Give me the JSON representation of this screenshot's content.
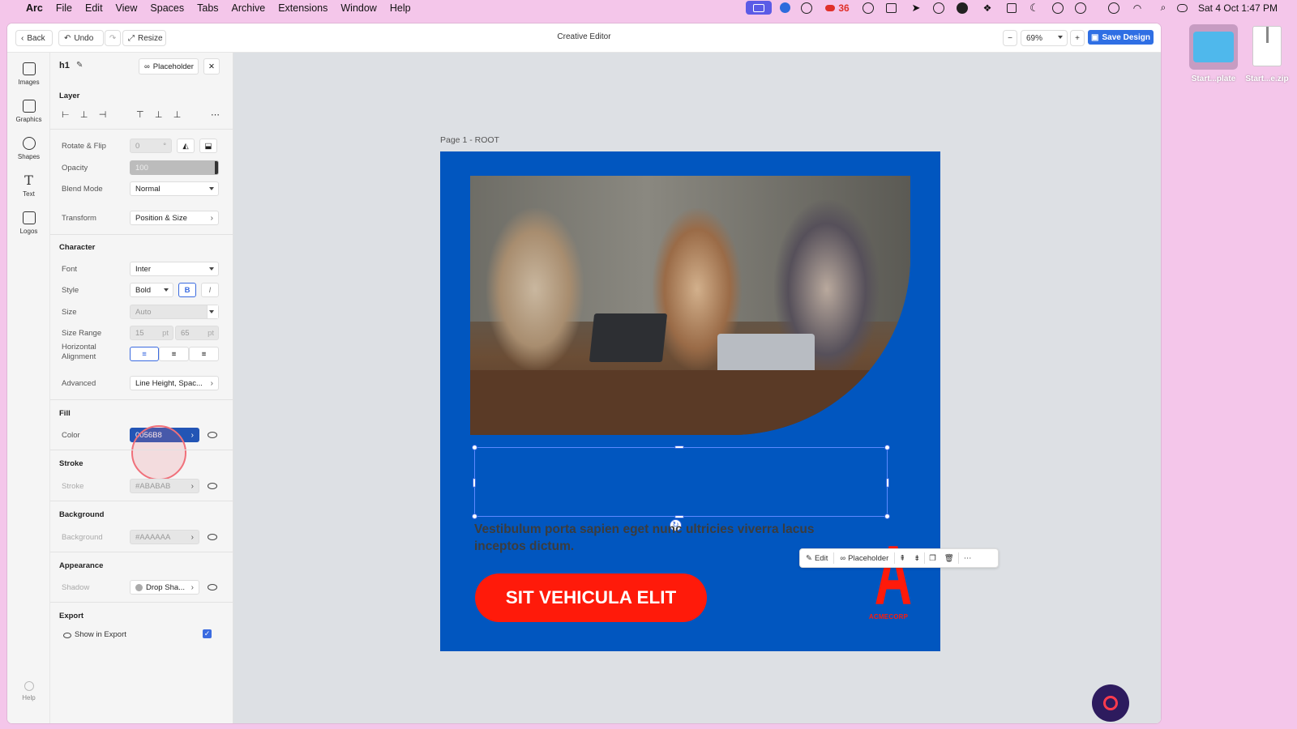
{
  "menubar": {
    "app": "Arc",
    "items": [
      "File",
      "Edit",
      "View",
      "Spaces",
      "Tabs",
      "Archive",
      "Extensions",
      "Window",
      "Help"
    ],
    "badge_count": "36",
    "clock": "Sat 4 Oct  1:47 PM"
  },
  "toolbar": {
    "back": "Back",
    "undo": "Undo",
    "resize": "Resize",
    "title": "Creative Editor",
    "zoom": "69%",
    "save": "Save Design"
  },
  "rail": [
    "Images",
    "Graphics",
    "Shapes",
    "Text",
    "Logos"
  ],
  "rail_help": "Help",
  "panel": {
    "element_name": "h1",
    "placeholder_btn": "Placeholder",
    "layer_title": "Layer",
    "rotate_label": "Rotate & Flip",
    "rotate_value": "0",
    "rotate_unit": "°",
    "opacity_label": "Opacity",
    "opacity_value": "100",
    "blend_label": "Blend Mode",
    "blend_value": "Normal",
    "transform_label": "Transform",
    "transform_value": "Position & Size",
    "character_title": "Character",
    "font_label": "Font",
    "font_value": "Inter",
    "style_label": "Style",
    "style_value": "Bold",
    "bold_glyph": "B",
    "italic_glyph": "I",
    "size_label": "Size",
    "size_value": "Auto",
    "range_label": "Size Range",
    "range_min": "15",
    "range_max": "65",
    "range_unit": "pt",
    "halign_label": "Horizontal Alignment",
    "advanced_label": "Advanced",
    "advanced_value": "Line Height, Spac...",
    "fill_title": "Fill",
    "color_label": "Color",
    "color_value": "0056B8",
    "stroke_title": "Stroke",
    "stroke_label": "Stroke",
    "stroke_value": "#ABABAB",
    "background_title": "Background",
    "background_label": "Background",
    "background_value": "#AAAAAA",
    "appearance_title": "Appearance",
    "shadow_label": "Shadow",
    "shadow_value": "Drop Sha...",
    "export_title": "Export",
    "show_export": "Show in Export",
    "show_export_checked": true
  },
  "canvas": {
    "page_label": "Page 1 - ROOT",
    "body_text": "Vestibulum porta sapien eget nunc ultricies viverra lacus inceptos dictum.",
    "cta": "SIT VEHICULA ELIT",
    "logo_letter": "A",
    "logo_caption": "ACMECORP",
    "float_edit": "Edit",
    "float_placeholder": "Placeholder"
  },
  "desktop": [
    {
      "label": "Start...plate"
    },
    {
      "label": "Start...e.zip"
    }
  ],
  "colors": {
    "design_bg": "#0156bf",
    "cta": "#ff1a0a",
    "accent": "#2f6fe4",
    "desktop": "#f4c6ea"
  }
}
